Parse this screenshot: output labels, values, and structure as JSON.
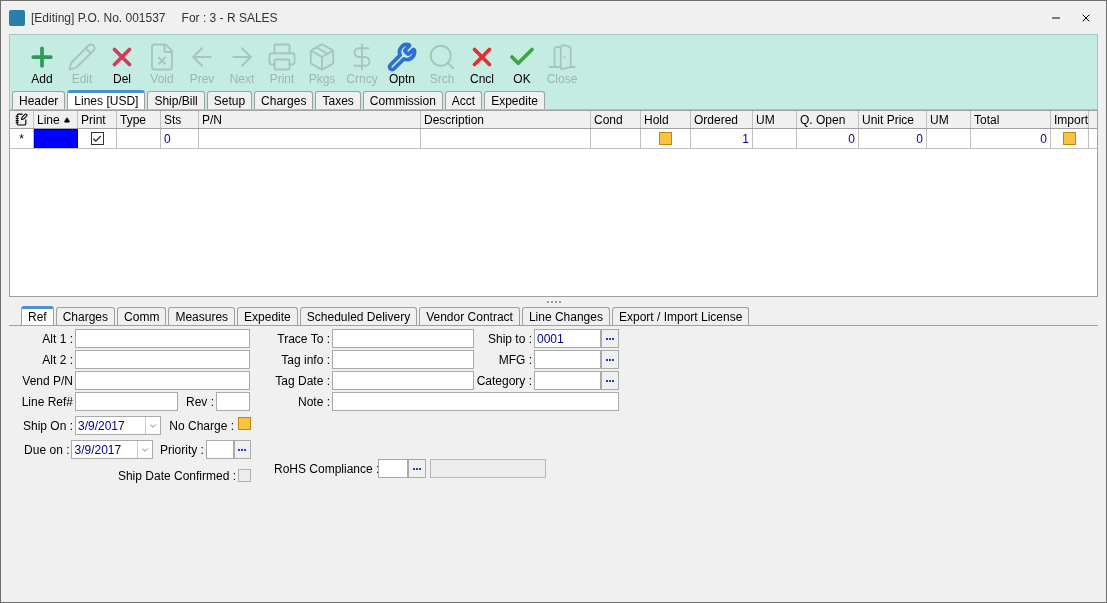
{
  "window": {
    "title": "[Editing] P.O. No. 001537",
    "subtitle": "For : 3 - R SALES"
  },
  "toolbar": [
    {
      "label": "Add",
      "disabled": false
    },
    {
      "label": "Edit",
      "disabled": true
    },
    {
      "label": "Del",
      "disabled": false
    },
    {
      "label": "Void",
      "disabled": true
    },
    {
      "label": "Prev",
      "disabled": true
    },
    {
      "label": "Next",
      "disabled": true
    },
    {
      "label": "Print",
      "disabled": true
    },
    {
      "label": "Pkgs",
      "disabled": true
    },
    {
      "label": "Crncy",
      "disabled": true
    },
    {
      "label": "Optn",
      "disabled": false
    },
    {
      "label": "Srch",
      "disabled": true
    },
    {
      "label": "Cncl",
      "disabled": false
    },
    {
      "label": "OK",
      "disabled": false
    },
    {
      "label": "Close",
      "disabled": true
    }
  ],
  "tabs": [
    {
      "label": "Header",
      "selected": false
    },
    {
      "label": "Lines [USD]",
      "selected": true
    },
    {
      "label": "Ship/Bill",
      "selected": false
    },
    {
      "label": "Setup",
      "selected": false
    },
    {
      "label": "Charges",
      "selected": false
    },
    {
      "label": "Taxes",
      "selected": false
    },
    {
      "label": "Commission",
      "selected": false
    },
    {
      "label": "Acct",
      "selected": false
    },
    {
      "label": "Expedite",
      "selected": false
    }
  ],
  "table": {
    "columns": [
      "Line",
      "Print",
      "Type",
      "Sts",
      "P/N",
      "Description",
      "Cond",
      "Hold",
      "Ordered",
      "UM",
      "Q. Open",
      "Unit Price",
      "UM",
      "Total",
      "Import"
    ],
    "rows": [
      {
        "marker": "*",
        "line_selected": true,
        "print": true,
        "sts": "0",
        "hold": false,
        "ordered": "1",
        "q_open": "0",
        "unit_price": "0",
        "total": "0",
        "import": false
      }
    ]
  },
  "detail_tabs": [
    {
      "label": "Ref",
      "selected": true
    },
    {
      "label": "Charges",
      "selected": false
    },
    {
      "label": "Comm",
      "selected": false
    },
    {
      "label": "Measures",
      "selected": false
    },
    {
      "label": "Expedite",
      "selected": false
    },
    {
      "label": "Scheduled Delivery",
      "selected": false
    },
    {
      "label": "Vendor Contract",
      "selected": false
    },
    {
      "label": "Line Changes",
      "selected": false
    },
    {
      "label": "Export / Import License",
      "selected": false
    }
  ],
  "ref": {
    "alt1": {
      "label": "Alt 1 :"
    },
    "alt2": {
      "label": "Alt 2 :"
    },
    "vend_pn": {
      "label": "Vend P/N"
    },
    "line_ref": {
      "label": "Line Ref#"
    },
    "rev": {
      "label": "Rev :"
    },
    "ship_on": {
      "label": "Ship On :",
      "value": "3/9/2017"
    },
    "due_on": {
      "label": "Due on :",
      "value": "3/9/2017"
    },
    "no_charge": {
      "label": "No Charge :",
      "checked": false
    },
    "priority": {
      "label": "Priority :"
    },
    "ship_date_confirmed": {
      "label": "Ship Date Confirmed :",
      "checked": false,
      "disabled": true
    },
    "trace_to": {
      "label": "Trace To :"
    },
    "tag_info": {
      "label": "Tag info :"
    },
    "tag_date": {
      "label": "Tag Date :"
    },
    "note": {
      "label": "Note :"
    },
    "ship_to": {
      "label": "Ship to :",
      "value": "0001"
    },
    "mfg": {
      "label": "MFG :"
    },
    "category": {
      "label": "Category :"
    },
    "rohs": {
      "label": "RoHS Compliance :"
    }
  }
}
